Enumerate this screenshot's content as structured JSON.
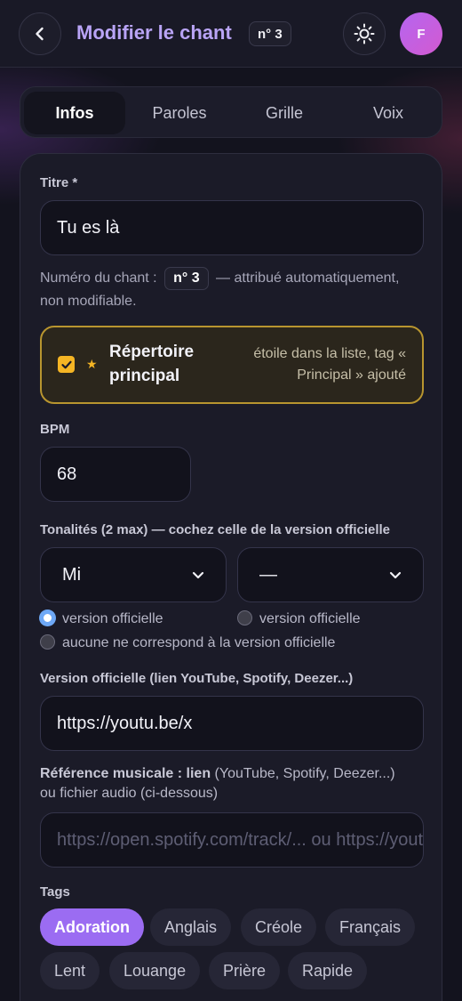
{
  "header": {
    "title": "Modifier le chant",
    "number_badge": "n° 3",
    "avatar_initial": "F"
  },
  "tabs": [
    {
      "label": "Infos",
      "active": true
    },
    {
      "label": "Paroles",
      "active": false
    },
    {
      "label": "Grille",
      "active": false
    },
    {
      "label": "Voix",
      "active": false
    }
  ],
  "form": {
    "title_label": "Titre *",
    "title_value": "Tu es là",
    "number_hint_prefix": "Numéro du chant :",
    "number_hint_badge": "n° 3",
    "number_hint_suffix": "— attribué automatiquement, non modifiable.",
    "repertoire": {
      "label": "Répertoire principal",
      "checked": true,
      "note": "étoile dans la liste, tag « Principal » ajouté"
    },
    "bpm_label": "BPM",
    "bpm_value": "68",
    "keys_label": "Tonalités (2 max) — cochez celle de la version officielle",
    "key1_value": "Mi",
    "key2_value": "—",
    "radio1_label": "version officielle",
    "radio2_label": "version officielle",
    "radio3_label": "aucune ne correspond à la version officielle",
    "official_label": "Version officielle (lien YouTube, Spotify, Deezer...)",
    "official_value": "https://youtu.be/x",
    "ref_label_bold": "Référence musicale : lien",
    "ref_label_rest": "(YouTube, Spotify, Deezer...)",
    "ref_label_line2": "ou fichier audio (ci-dessous)",
    "ref_placeholder": "https://open.spotify.com/track/... ou https://youtu.be/...",
    "tags_label": "Tags",
    "tags": [
      {
        "label": "Adoration",
        "active": true
      },
      {
        "label": "Anglais",
        "active": false
      },
      {
        "label": "Créole",
        "active": false
      },
      {
        "label": "Français",
        "active": false
      },
      {
        "label": "Lent",
        "active": false
      },
      {
        "label": "Louange",
        "active": false
      },
      {
        "label": "Prière",
        "active": false
      },
      {
        "label": "Rapide",
        "active": false
      }
    ]
  },
  "colors": {
    "accent": "#9b6cf2",
    "title": "#b9a4f6",
    "repertoire_border": "#b8952f",
    "checkbox": "#f5b524"
  }
}
